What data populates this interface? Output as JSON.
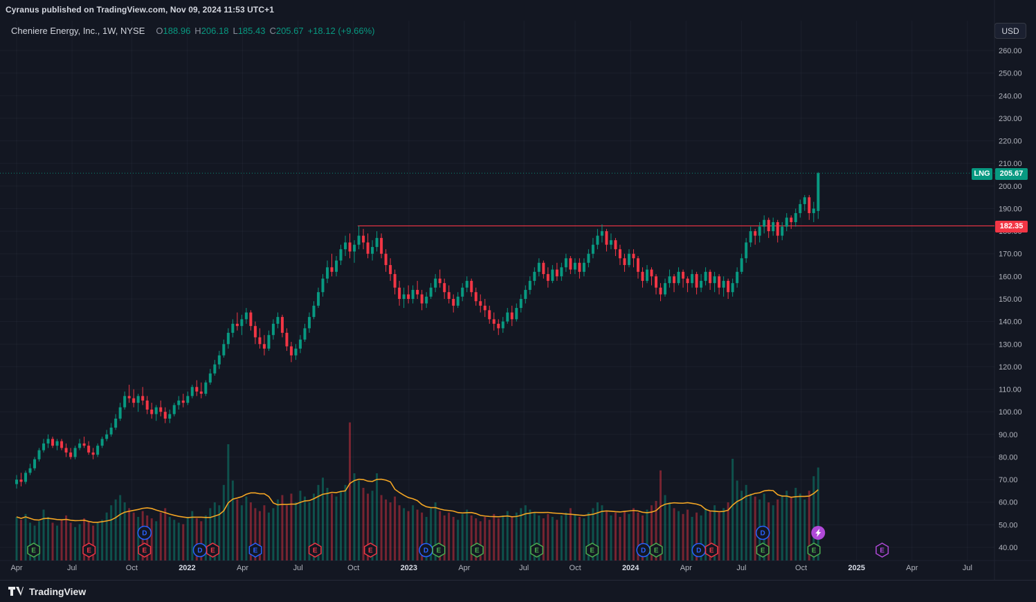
{
  "header": {
    "publisher": "Cyranus published on TradingView.com, Nov 09, 2024 11:53 UTC+1"
  },
  "legend": {
    "symbol_title": "Cheniere Energy, Inc., 1W, NYSE",
    "o_label": "O",
    "o": "188.96",
    "h_label": "H",
    "h": "206.18",
    "l_label": "L",
    "l": "185.43",
    "c_label": "C",
    "c": "205.67",
    "change": "+18.12 (+9.66%)"
  },
  "currency_button": "USD",
  "price_labels": {
    "symbol": "LNG",
    "current": "205.67",
    "level": "182.35"
  },
  "footer": {
    "brand": "TradingView"
  },
  "price_axis": {
    "ticks": [
      "260.00",
      "250.00",
      "240.00",
      "230.00",
      "220.00",
      "210.00",
      "200.00",
      "190.00",
      "180.00",
      "170.00",
      "160.00",
      "150.00",
      "140.00",
      "130.00",
      "120.00",
      "110.00",
      "100.00",
      "90.00",
      "80.00",
      "70.00",
      "60.00",
      "50.00",
      "40.00"
    ]
  },
  "time_axis": {
    "labels": [
      {
        "text": "Apr",
        "week": 0
      },
      {
        "text": "Jul",
        "week": 13
      },
      {
        "text": "Oct",
        "week": 27
      },
      {
        "text": "2022",
        "week": 40,
        "year": true
      },
      {
        "text": "Apr",
        "week": 53
      },
      {
        "text": "Jul",
        "week": 66
      },
      {
        "text": "Oct",
        "week": 79
      },
      {
        "text": "2023",
        "week": 92,
        "year": true
      },
      {
        "text": "Apr",
        "week": 105
      },
      {
        "text": "Jul",
        "week": 119
      },
      {
        "text": "Oct",
        "week": 131
      },
      {
        "text": "2024",
        "week": 144,
        "year": true
      },
      {
        "text": "Apr",
        "week": 157
      },
      {
        "text": "Jul",
        "week": 170
      },
      {
        "text": "Oct",
        "week": 184
      },
      {
        "text": "2025",
        "week": 197,
        "year": true
      },
      {
        "text": "Apr",
        "week": 210
      },
      {
        "text": "Jul",
        "week": 223
      }
    ]
  },
  "colors": {
    "bg": "#131722",
    "up": "#089981",
    "down": "#f23645",
    "vol_up": "rgba(8,153,129,0.45)",
    "vol_down": "rgba(242,54,69,0.45)",
    "vol_ma": "#f5a623",
    "grid": "rgba(110,120,140,0.09)",
    "axis_text": "#b2b5be",
    "axis_text_bright": "#d8dce6",
    "badge": {
      "green": "#4caf50",
      "red": "#f23645",
      "blue": "#2962ff",
      "purple": "#b049d8"
    }
  },
  "chart_data": {
    "type": "candlestick",
    "symbol": "LNG",
    "exchange": "NYSE",
    "timeframe": "1W",
    "ylim": [
      40,
      260
    ],
    "price_line": 205.67,
    "horizontal_level": {
      "price": 182.35,
      "start_week": 80
    },
    "weeks_span": 223,
    "volume_ma_period": 10,
    "candles": [
      [
        68,
        72,
        66,
        70
      ],
      [
        70,
        73,
        67,
        69
      ],
      [
        69,
        74,
        68,
        73
      ],
      [
        73,
        77,
        72,
        75
      ],
      [
        75,
        80,
        74,
        79
      ],
      [
        79,
        84,
        78,
        83
      ],
      [
        83,
        88,
        82,
        86
      ],
      [
        86,
        90,
        84,
        88
      ],
      [
        88,
        89,
        84,
        85
      ],
      [
        85,
        88,
        83,
        87
      ],
      [
        87,
        88,
        83,
        84
      ],
      [
        84,
        86,
        80,
        82
      ],
      [
        82,
        84,
        79,
        80
      ],
      [
        80,
        85,
        79,
        84
      ],
      [
        84,
        88,
        83,
        86
      ],
      [
        86,
        89,
        84,
        85
      ],
      [
        85,
        87,
        81,
        82
      ],
      [
        82,
        84,
        79,
        81
      ],
      [
        81,
        86,
        80,
        85
      ],
      [
        85,
        89,
        84,
        88
      ],
      [
        88,
        92,
        87,
        90
      ],
      [
        90,
        95,
        89,
        93
      ],
      [
        93,
        99,
        92,
        97
      ],
      [
        97,
        104,
        96,
        102
      ],
      [
        102,
        109,
        101,
        107
      ],
      [
        107,
        112,
        104,
        106
      ],
      [
        106,
        110,
        102,
        104
      ],
      [
        104,
        108,
        100,
        107
      ],
      [
        107,
        111,
        103,
        105
      ],
      [
        105,
        107,
        99,
        101
      ],
      [
        101,
        104,
        97,
        99
      ],
      [
        99,
        103,
        96,
        102
      ],
      [
        102,
        105,
        98,
        100
      ],
      [
        100,
        102,
        95,
        97
      ],
      [
        97,
        101,
        95,
        99
      ],
      [
        99,
        104,
        98,
        103
      ],
      [
        103,
        107,
        101,
        105
      ],
      [
        105,
        108,
        102,
        104
      ],
      [
        104,
        109,
        103,
        107
      ],
      [
        107,
        112,
        106,
        111
      ],
      [
        111,
        114,
        107,
        109
      ],
      [
        109,
        113,
        106,
        108
      ],
      [
        108,
        114,
        107,
        113
      ],
      [
        113,
        119,
        112,
        117
      ],
      [
        117,
        123,
        116,
        121
      ],
      [
        121,
        127,
        119,
        125
      ],
      [
        125,
        132,
        124,
        130
      ],
      [
        130,
        137,
        128,
        135
      ],
      [
        135,
        141,
        133,
        139
      ],
      [
        139,
        144,
        136,
        138
      ],
      [
        138,
        143,
        134,
        141
      ],
      [
        141,
        146,
        139,
        144
      ],
      [
        144,
        145,
        136,
        138
      ],
      [
        138,
        140,
        130,
        133
      ],
      [
        133,
        137,
        128,
        130
      ],
      [
        130,
        134,
        125,
        128
      ],
      [
        128,
        136,
        127,
        134
      ],
      [
        134,
        141,
        132,
        139
      ],
      [
        139,
        144,
        137,
        142
      ],
      [
        142,
        143,
        133,
        135
      ],
      [
        135,
        137,
        127,
        129
      ],
      [
        129,
        131,
        122,
        125
      ],
      [
        125,
        130,
        123,
        128
      ],
      [
        128,
        134,
        126,
        132
      ],
      [
        132,
        139,
        131,
        137
      ],
      [
        137,
        144,
        135,
        142
      ],
      [
        142,
        149,
        141,
        147
      ],
      [
        147,
        155,
        146,
        153
      ],
      [
        153,
        161,
        151,
        159
      ],
      [
        159,
        167,
        157,
        164
      ],
      [
        164,
        170,
        160,
        162
      ],
      [
        162,
        169,
        160,
        167
      ],
      [
        167,
        174,
        165,
        172
      ],
      [
        172,
        178,
        169,
        175
      ],
      [
        175,
        179,
        168,
        171
      ],
      [
        171,
        176,
        166,
        174
      ],
      [
        174,
        182.35,
        172,
        178
      ],
      [
        178,
        181,
        172,
        175
      ],
      [
        175,
        179,
        168,
        170
      ],
      [
        170,
        176,
        167,
        173
      ],
      [
        173,
        180,
        171,
        177
      ],
      [
        177,
        179,
        168,
        170
      ],
      [
        170,
        172,
        162,
        165
      ],
      [
        165,
        168,
        158,
        161
      ],
      [
        161,
        163,
        152,
        155
      ],
      [
        155,
        158,
        147,
        150
      ],
      [
        150,
        155,
        146,
        152
      ],
      [
        152,
        156,
        148,
        150
      ],
      [
        150,
        156,
        148,
        154
      ],
      [
        154,
        158,
        150,
        152
      ],
      [
        152,
        154,
        145,
        148
      ],
      [
        148,
        153,
        146,
        151
      ],
      [
        151,
        157,
        150,
        155
      ],
      [
        155,
        161,
        153,
        159
      ],
      [
        159,
        163,
        155,
        157
      ],
      [
        157,
        159,
        150,
        153
      ],
      [
        153,
        156,
        148,
        150
      ],
      [
        150,
        152,
        144,
        147
      ],
      [
        147,
        153,
        146,
        151
      ],
      [
        151,
        157,
        149,
        155
      ],
      [
        155,
        160,
        153,
        158
      ],
      [
        158,
        159,
        151,
        153
      ],
      [
        153,
        155,
        147,
        149
      ],
      [
        149,
        152,
        144,
        147
      ],
      [
        147,
        150,
        142,
        145
      ],
      [
        145,
        147,
        139,
        141
      ],
      [
        141,
        144,
        136,
        139
      ],
      [
        139,
        141,
        134,
        137
      ],
      [
        137,
        142,
        135,
        140
      ],
      [
        140,
        146,
        139,
        144
      ],
      [
        144,
        147,
        138,
        141
      ],
      [
        141,
        148,
        140,
        146
      ],
      [
        146,
        152,
        144,
        150
      ],
      [
        150,
        156,
        148,
        154
      ],
      [
        154,
        160,
        152,
        158
      ],
      [
        158,
        164,
        156,
        162
      ],
      [
        162,
        168,
        160,
        166
      ],
      [
        166,
        167,
        159,
        161
      ],
      [
        161,
        164,
        155,
        158
      ],
      [
        158,
        165,
        157,
        163
      ],
      [
        163,
        166,
        158,
        160
      ],
      [
        160,
        166,
        158,
        164
      ],
      [
        164,
        170,
        162,
        168
      ],
      [
        168,
        169,
        161,
        163
      ],
      [
        163,
        168,
        161,
        166
      ],
      [
        166,
        168,
        159,
        162
      ],
      [
        162,
        168,
        160,
        166
      ],
      [
        166,
        172,
        164,
        170
      ],
      [
        170,
        177,
        168,
        174
      ],
      [
        174,
        181,
        172,
        178
      ],
      [
        178,
        183,
        175,
        180
      ],
      [
        180,
        181,
        171,
        174
      ],
      [
        174,
        179,
        172,
        176
      ],
      [
        176,
        177,
        169,
        172
      ],
      [
        172,
        174,
        165,
        168
      ],
      [
        168,
        170,
        162,
        165
      ],
      [
        165,
        172,
        164,
        170
      ],
      [
        170,
        172,
        164,
        168
      ],
      [
        168,
        169,
        159,
        162
      ],
      [
        162,
        164,
        155,
        158
      ],
      [
        158,
        165,
        157,
        163
      ],
      [
        163,
        164,
        156,
        160
      ],
      [
        160,
        161,
        152,
        155
      ],
      [
        155,
        157,
        149,
        152
      ],
      [
        152,
        159,
        151,
        157
      ],
      [
        157,
        163,
        155,
        160
      ],
      [
        160,
        161,
        153,
        157
      ],
      [
        157,
        164,
        156,
        162
      ],
      [
        162,
        163,
        155,
        159
      ],
      [
        159,
        160,
        153,
        157
      ],
      [
        157,
        163,
        155,
        161
      ],
      [
        161,
        162,
        152,
        155
      ],
      [
        155,
        161,
        153,
        158
      ],
      [
        158,
        164,
        156,
        162
      ],
      [
        162,
        163,
        154,
        157
      ],
      [
        157,
        162,
        153,
        160
      ],
      [
        160,
        161,
        152,
        155
      ],
      [
        155,
        160,
        151,
        158
      ],
      [
        158,
        159,
        150,
        153
      ],
      [
        153,
        159,
        151,
        157
      ],
      [
        157,
        164,
        155,
        162
      ],
      [
        162,
        170,
        161,
        168
      ],
      [
        168,
        177,
        166,
        175
      ],
      [
        175,
        182,
        173,
        180
      ],
      [
        180,
        181,
        174,
        178
      ],
      [
        178,
        184,
        175,
        182
      ],
      [
        182,
        187,
        179,
        185
      ],
      [
        185,
        186,
        177,
        180
      ],
      [
        180,
        186,
        178,
        184
      ],
      [
        184,
        185,
        175,
        178
      ],
      [
        178,
        184,
        176,
        182
      ],
      [
        182,
        188,
        180,
        186
      ],
      [
        186,
        187,
        181,
        184
      ],
      [
        184,
        190,
        182,
        188
      ],
      [
        188,
        194,
        186,
        192
      ],
      [
        192,
        196,
        189,
        195
      ],
      [
        195,
        196,
        185,
        188
      ],
      [
        188,
        193,
        184,
        190
      ],
      [
        188.96,
        206.18,
        185.43,
        205.67
      ]
    ],
    "volume": [
      30,
      28,
      32,
      26,
      24,
      27,
      35,
      30,
      26,
      24,
      28,
      31,
      26,
      23,
      25,
      29,
      27,
      24,
      26,
      28,
      33,
      38,
      42,
      45,
      40,
      36,
      33,
      30,
      34,
      31,
      29,
      27,
      33,
      36,
      30,
      28,
      26,
      25,
      30,
      34,
      29,
      27,
      31,
      36,
      40,
      38,
      52,
      80,
      55,
      42,
      38,
      44,
      40,
      36,
      34,
      38,
      33,
      36,
      42,
      45,
      38,
      46,
      40,
      48,
      44,
      40,
      46,
      52,
      57,
      50,
      46,
      44,
      48,
      52,
      95,
      60,
      55,
      50,
      46,
      48,
      60,
      45,
      42,
      40,
      44,
      38,
      36,
      34,
      38,
      35,
      33,
      30,
      36,
      40,
      34,
      31,
      33,
      30,
      28,
      32,
      35,
      31,
      29,
      27,
      30,
      28,
      32,
      29,
      31,
      34,
      30,
      33,
      36,
      38,
      35,
      33,
      31,
      29,
      32,
      30,
      28,
      31,
      33,
      36,
      32,
      30,
      29,
      33,
      36,
      40,
      38,
      34,
      31,
      33,
      30,
      34,
      32,
      36,
      33,
      31,
      35,
      38,
      41,
      62,
      45,
      40,
      36,
      34,
      32,
      35,
      30,
      33,
      31,
      36,
      34,
      38,
      33,
      36,
      40,
      70,
      55,
      48,
      52,
      46,
      44,
      42,
      46,
      40,
      38,
      42,
      45,
      48,
      44,
      50,
      46,
      42,
      48,
      58,
      64
    ],
    "events": [
      {
        "week": 4,
        "shape": "E",
        "color": "green",
        "row": 0
      },
      {
        "week": 17,
        "shape": "E",
        "color": "red",
        "row": 0
      },
      {
        "week": 30,
        "shape": "D",
        "color": "blue",
        "row": 1
      },
      {
        "week": 30,
        "shape": "E",
        "color": "red",
        "row": 0
      },
      {
        "week": 43,
        "shape": "D",
        "color": "blue",
        "row": 0
      },
      {
        "week": 46,
        "shape": "E",
        "color": "red",
        "row": 0
      },
      {
        "week": 56,
        "shape": "E",
        "color": "blue",
        "row": 0
      },
      {
        "week": 70,
        "shape": "E",
        "color": "red",
        "row": 0
      },
      {
        "week": 83,
        "shape": "E",
        "color": "red",
        "row": 0
      },
      {
        "week": 96,
        "shape": "D",
        "color": "blue",
        "row": 0
      },
      {
        "week": 99,
        "shape": "E",
        "color": "green",
        "row": 0
      },
      {
        "week": 108,
        "shape": "E",
        "color": "green",
        "row": 0
      },
      {
        "week": 122,
        "shape": "E",
        "color": "green",
        "row": 0
      },
      {
        "week": 135,
        "shape": "E",
        "color": "green",
        "row": 0
      },
      {
        "week": 147,
        "shape": "D",
        "color": "blue",
        "row": 0
      },
      {
        "week": 150,
        "shape": "E",
        "color": "green",
        "row": 0
      },
      {
        "week": 160,
        "shape": "D",
        "color": "blue",
        "row": 0
      },
      {
        "week": 163,
        "shape": "E",
        "color": "red",
        "row": 0
      },
      {
        "week": 175,
        "shape": "D",
        "color": "blue",
        "row": 1
      },
      {
        "week": 175,
        "shape": "E",
        "color": "green",
        "row": 0
      },
      {
        "week": 187,
        "shape": "E",
        "color": "green",
        "row": 0
      },
      {
        "week": 188,
        "shape": "bolt",
        "color": "purple",
        "row": 1
      },
      {
        "week": 203,
        "shape": "E",
        "color": "purple",
        "row": 0
      }
    ]
  }
}
